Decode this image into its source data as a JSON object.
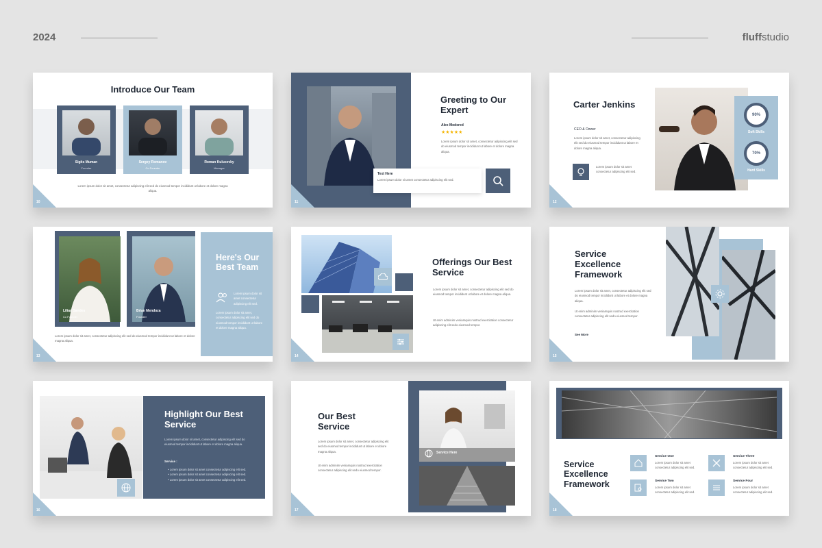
{
  "header": {
    "year": "2024",
    "brand_bold": "fluff",
    "brand_light": "studio"
  },
  "lorem1": "Lorem ipsum dolor sit amet, consectetur adipiscing elit sed do eiusmod tempor incididunt ut labore et dolore magna aliqua.",
  "lorem2": "Ut enim adminim veniamquis nostrud exercitation consectetur adipiscing elit sedo eiusmod tempor.",
  "lorem_short": "Lorem ipsum dolor sit amet consectetur adipiscing elit sed.",
  "slides": {
    "s10": {
      "num": "10",
      "title": "Introduce Our Team",
      "members": [
        {
          "name": "Sigits Muman",
          "role": "Founder"
        },
        {
          "name": "Sergey Romanov",
          "role": "Co Founder"
        },
        {
          "name": "Roman Kulucevky",
          "role": "Manager"
        }
      ]
    },
    "s11": {
      "num": "11",
      "title": "Greeting to Our Expert",
      "person": "Alex Modered",
      "stars": "★★★★★",
      "text_here": "Text Here"
    },
    "s12": {
      "num": "12",
      "title": "Carter Jenkins",
      "role": "CEO & Owner",
      "skill1_pct": "90%",
      "skill1": "Soft Skills",
      "skill2_pct": "70%",
      "skill2": "Hard Skills"
    },
    "s13": {
      "num": "13",
      "title": "Here's Our Best Team",
      "member1": "Lilian Sandes",
      "role1": "Co Founder",
      "member2": "Brian Mendoza",
      "role2": "Founder"
    },
    "s14": {
      "num": "14",
      "title": "Offerings Our Best Service"
    },
    "s15": {
      "num": "15",
      "title": "Service Excellence Framework",
      "link": "See More"
    },
    "s16": {
      "num": "16",
      "title": "Highlight Our Best Service",
      "service_label": "Service :"
    },
    "s17": {
      "num": "17",
      "title": "Our Best Service",
      "caption": "Service Here"
    },
    "s18": {
      "num": "18",
      "title": "Service Excellence Framework",
      "services": [
        {
          "name": "Service One"
        },
        {
          "name": "Service Three"
        },
        {
          "name": "Service Two"
        },
        {
          "name": "Service Four"
        }
      ]
    }
  },
  "icons": [
    "lightbulb-icon",
    "search-icon",
    "users-icon",
    "cloud-icon",
    "sliders-icon",
    "gear-icon",
    "globe-icon",
    "home-icon",
    "tools-icon",
    "document-search-icon"
  ]
}
